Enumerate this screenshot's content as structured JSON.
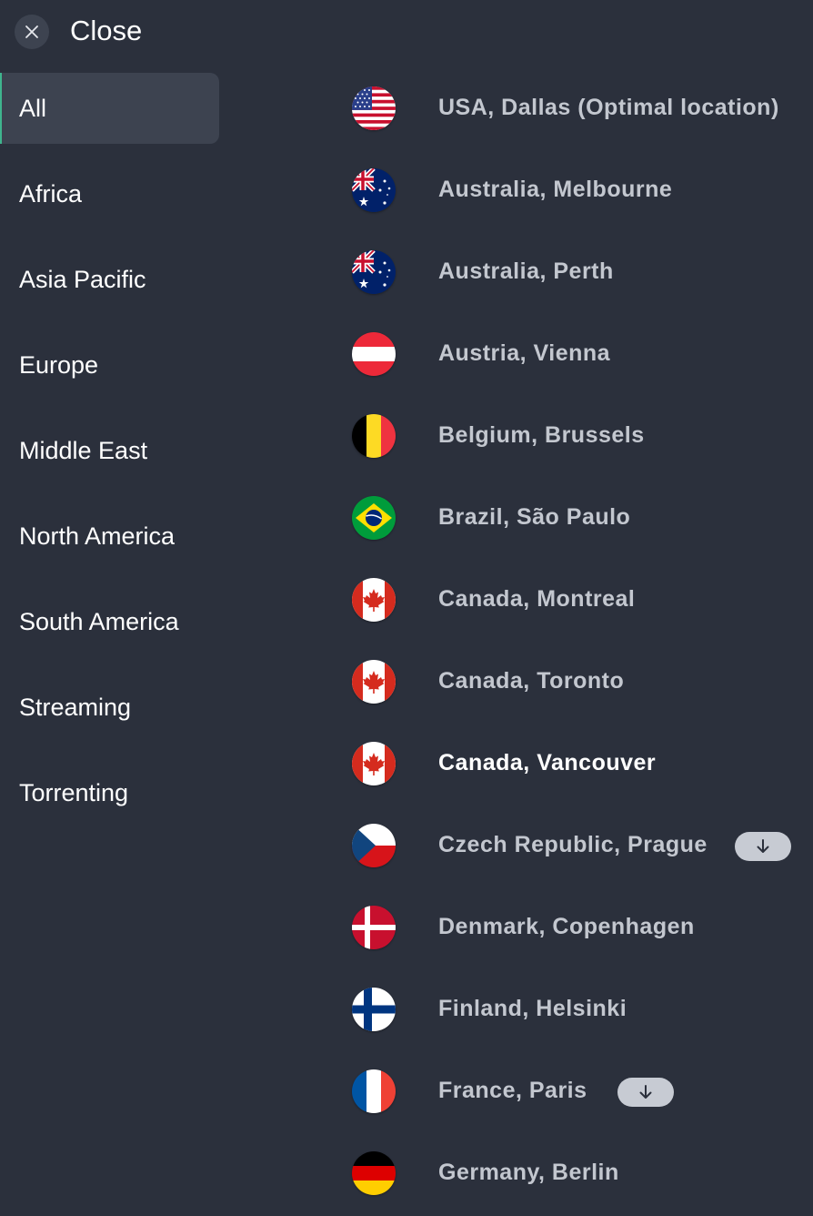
{
  "header": {
    "close_label": "Close"
  },
  "sidebar": {
    "items": [
      {
        "label": "All",
        "active": true
      },
      {
        "label": "Africa"
      },
      {
        "label": "Asia Pacific"
      },
      {
        "label": "Europe"
      },
      {
        "label": "Middle East"
      },
      {
        "label": "North America"
      },
      {
        "label": "South America"
      },
      {
        "label": "Streaming"
      },
      {
        "label": "Torrenting"
      }
    ]
  },
  "servers": [
    {
      "name": "USA, Dallas (Optimal location)",
      "flag": "flag-usa-icon"
    },
    {
      "name": "Australia, Melbourne",
      "flag": "flag-australia-icon"
    },
    {
      "name": "Australia, Perth",
      "flag": "flag-australia-icon"
    },
    {
      "name": "Austria, Vienna",
      "flag": "flag-austria-icon"
    },
    {
      "name": "Belgium, Brussels",
      "flag": "flag-belgium-icon"
    },
    {
      "name": "Brazil, São Paulo",
      "flag": "flag-brazil-icon"
    },
    {
      "name": "Canada, Montreal",
      "flag": "flag-canada-icon"
    },
    {
      "name": "Canada, Toronto",
      "flag": "flag-canada-icon"
    },
    {
      "name": "Canada, Vancouver",
      "flag": "flag-canada-icon",
      "highlight": true
    },
    {
      "name": "Czech Republic, Prague",
      "flag": "flag-czech-icon",
      "badge": "download-arrow-icon"
    },
    {
      "name": "Denmark, Copenhagen",
      "flag": "flag-denmark-icon"
    },
    {
      "name": "Finland, Helsinki",
      "flag": "flag-finland-icon"
    },
    {
      "name": "France, Paris",
      "flag": "flag-france-icon",
      "badge": "download-arrow-icon"
    },
    {
      "name": "Germany, Berlin",
      "flag": "flag-germany-icon"
    }
  ],
  "colors": {
    "background": "#2b303c",
    "active_item": "#3d4350",
    "accent": "#3fb58e",
    "text_muted": "#c3c7cf"
  }
}
